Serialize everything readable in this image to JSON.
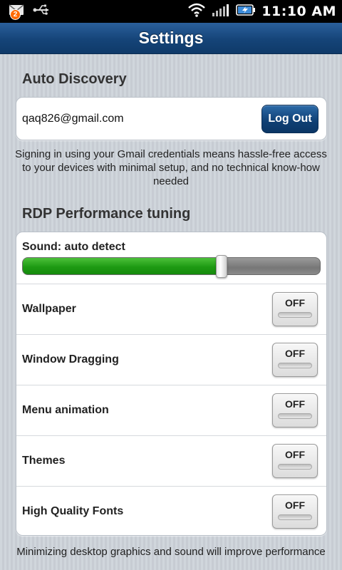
{
  "status_bar": {
    "notification_count": "2",
    "time": "11:10 AM",
    "icons": [
      "email-notification-icon",
      "usb-icon",
      "wifi-icon",
      "signal-icon",
      "battery-icon"
    ]
  },
  "title": "Settings",
  "auto_discovery": {
    "heading": "Auto Discovery",
    "email": "qaq826@gmail.com",
    "logout_label": "Log Out",
    "description": "Signing in using your Gmail credentials means hassle-free access to your devices with minimal setup, and no technical know-how needed"
  },
  "rdp": {
    "heading": "RDP Performance tuning",
    "sound_label": "Sound: auto detect",
    "sound_level_percent": 67,
    "toggles": [
      {
        "label": "Wallpaper",
        "state": "OFF"
      },
      {
        "label": "Window Dragging",
        "state": "OFF"
      },
      {
        "label": "Menu animation",
        "state": "OFF"
      },
      {
        "label": "Themes",
        "state": "OFF"
      },
      {
        "label": "High Quality Fonts",
        "state": "OFF"
      }
    ],
    "footer": "Minimizing desktop graphics and sound will improve performance"
  },
  "colors": {
    "title_bar": "#154478",
    "slider_fill": "#1e9a13",
    "button": "#0f3f73"
  }
}
